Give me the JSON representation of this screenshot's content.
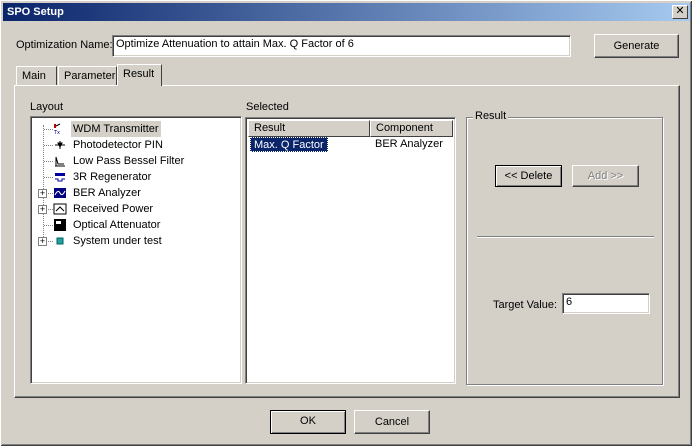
{
  "window": {
    "title": "SPO Setup",
    "close_glyph": "✕"
  },
  "optimization": {
    "label": "Optimization Name:",
    "value": "Optimize Attenuation to attain Max. Q Factor of 6"
  },
  "generate_label": "Generate",
  "tabs": [
    {
      "label": "Main",
      "active": false
    },
    {
      "label": "Parameter",
      "active": false
    },
    {
      "label": "Result",
      "active": true
    }
  ],
  "layout": {
    "label": "Layout",
    "items": [
      {
        "label": "WDM Transmitter",
        "icon": "transmitter-icon",
        "expandable": false,
        "selected": true
      },
      {
        "label": "Photodetector PIN",
        "icon": "photodetector-icon",
        "expandable": false,
        "selected": false
      },
      {
        "label": "Low Pass Bessel Filter",
        "icon": "filter-icon",
        "expandable": false,
        "selected": false
      },
      {
        "label": "3R Regenerator",
        "icon": "regenerator-icon",
        "expandable": false,
        "selected": false
      },
      {
        "label": "BER Analyzer",
        "icon": "ber-analyzer-icon",
        "expandable": true,
        "selected": false
      },
      {
        "label": "Received Power",
        "icon": "power-meter-icon",
        "expandable": true,
        "selected": false
      },
      {
        "label": "Optical Attenuator",
        "icon": "attenuator-icon",
        "expandable": false,
        "selected": false
      },
      {
        "label": "System under test",
        "icon": "subsystem-icon",
        "expandable": true,
        "selected": false
      }
    ]
  },
  "selected": {
    "label": "Selected",
    "columns": [
      "Result",
      "Component"
    ],
    "rows": [
      {
        "result": "Max. Q Factor",
        "component": "BER Analyzer"
      }
    ]
  },
  "result_group": {
    "label": "Result",
    "delete_label": "<< Delete",
    "add_label": "Add >>",
    "target_label": "Target Value:",
    "target_value": "6"
  },
  "buttons": {
    "ok": "OK",
    "cancel": "Cancel"
  },
  "colors": {
    "titlebar_start": "#0a246a",
    "titlebar_end": "#a6caf0",
    "selection": "#0a246a",
    "face": "#d4d0c8"
  }
}
